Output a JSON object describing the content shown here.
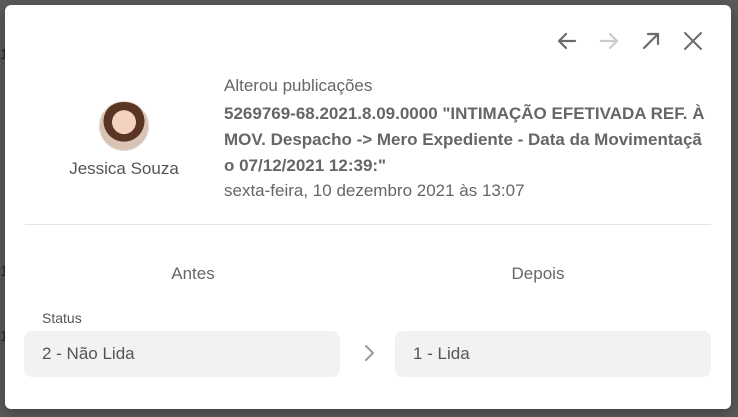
{
  "background": {
    "fragments": [
      "1",
      "1",
      "1",
      "1"
    ]
  },
  "toolbar": {
    "prev_icon": "arrow-left-icon",
    "next_icon": "arrow-right-icon",
    "expand_icon": "expand-icon",
    "close_icon": "close-icon"
  },
  "author": {
    "name": "Jessica Souza"
  },
  "event": {
    "action": "Alterou publicações",
    "description": "5269769-68.2021.8.09.0000 \"INTIMAÇÃO EFETIVADA REF. À MOV. Despacho -> Mero Expediente - Data da Movimentação 07/12/2021 12:39:\"",
    "date": "sexta-feira, 10 dezembro 2021 às 13:07"
  },
  "changes": {
    "before_title": "Antes",
    "after_title": "Depois",
    "field_label": "Status",
    "before_value": "2 - Não Lida",
    "after_value": "1 - Lida"
  },
  "colors": {
    "overlay": "#5c5c5c",
    "text": "#666666",
    "box": "#f2f2f2"
  }
}
